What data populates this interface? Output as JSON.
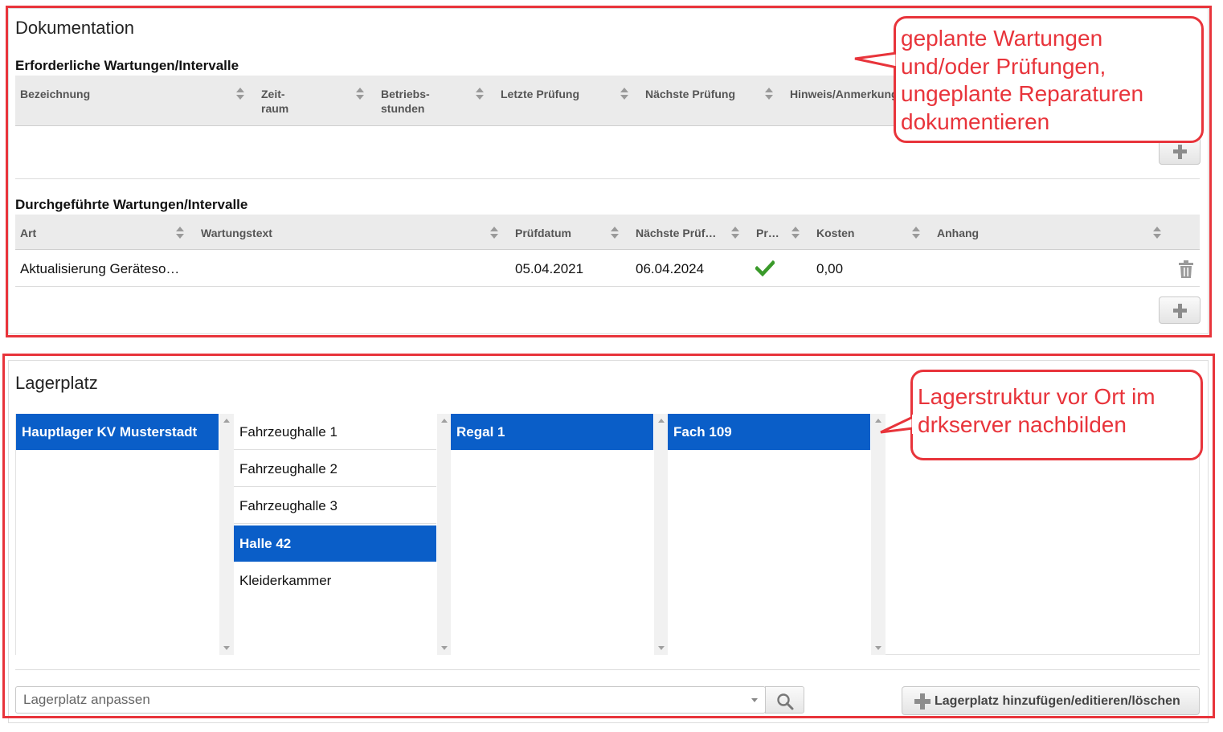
{
  "documentation": {
    "title": "Dokumentation",
    "required": {
      "title": "Erforderliche Wartungen/Intervalle",
      "columns": [
        "Bezeichnung",
        "Zeit-\nraum",
        "Betriebs-\nstunden",
        "Letzte Prüfung",
        "Nächste Prüfung",
        "Hinweis/Anmerkung"
      ]
    },
    "performed": {
      "title": "Durchgeführte Wartungen/Intervalle",
      "columns": [
        "Art",
        "Wartungstext",
        "Prüfdatum",
        "Nächste Prüf…",
        "Pr…",
        "Kosten",
        "Anhang"
      ],
      "rows": [
        {
          "art": "Aktualisierung Geräteso…",
          "text": "",
          "pruefdatum": "05.04.2021",
          "naechste": "06.04.2024",
          "passed_icon": "check-icon",
          "kosten": "0,00",
          "anhang": ""
        }
      ]
    }
  },
  "storage": {
    "title": "Lagerplatz",
    "lists": [
      {
        "items": [
          "Hauptlager KV Musterstadt"
        ],
        "selected": "Hauptlager KV Musterstadt"
      },
      {
        "items": [
          "Fahrzeughalle 1",
          "Fahrzeughalle 2",
          "Fahrzeughalle 3",
          "Halle 42",
          "Kleiderkammer"
        ],
        "selected": "Halle 42"
      },
      {
        "items": [
          "Regal 1"
        ],
        "selected": "Regal 1"
      },
      {
        "items": [
          "Fach 109"
        ],
        "selected": "Fach 109"
      }
    ],
    "search": {
      "value": "Lagerplatz anpassen"
    },
    "action_label": "Lagerplatz hinzufügen/editieren/löschen"
  },
  "callouts": {
    "doc": "geplante Wartungen\nund/oder Prüfungen,\nungeplante Reparaturen\ndokumentieren",
    "storage": "Lagerstruktur vor Ort im\ndrkserver nachbilden"
  },
  "colors": {
    "annotation_red": "#e8343b",
    "selection_blue": "#0a5ec8",
    "check_green": "#3a9a2a"
  }
}
